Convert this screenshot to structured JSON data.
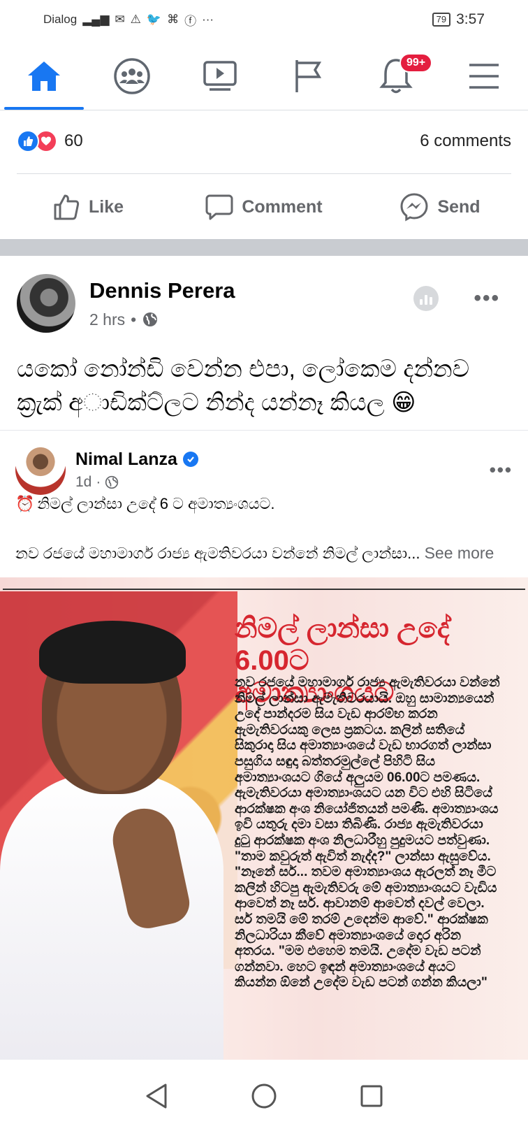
{
  "status_bar": {
    "carrier": "Dialog",
    "battery": "79",
    "time": "3:57",
    "icons": [
      "signal-icon",
      "mail-icon",
      "warning-icon",
      "twitter-icon",
      "app-icon",
      "facebook-icon",
      "more-icon"
    ]
  },
  "nav": {
    "items": [
      "home-icon",
      "groups-icon",
      "watch-icon",
      "pages-icon",
      "notifications-icon",
      "menu-icon"
    ],
    "notifications_badge": "99+",
    "accent": "#1877f2"
  },
  "engagement": {
    "reaction_count": "60",
    "comments_label": "6 comments"
  },
  "actions": {
    "like": "Like",
    "comment": "Comment",
    "send": "Send"
  },
  "post": {
    "author": "Dennis Perera",
    "time": "2 hrs",
    "separator": "•",
    "text_line1": "යකෝ නෝන්ඩි වෙන්න එපා, ලෝකෙම දන්නව",
    "text_line2": "ක්‍රැක් අාඩික්ට්ලට නින්ද යන්නෑ කියල",
    "emoji": "😁"
  },
  "shared": {
    "author": "Nimal Lanza",
    "time": "1d",
    "separator": "·",
    "line1_emoji": "⏰",
    "line1": "නිමල් ලාන්සා උදේ 6 ට අමාත්‍යංශයට.",
    "line2": "නව රජයේ මහාමාර්ග රාජ්‍ය ඇමතිවරයා වන්නේ නිමල් ලාන්සා...",
    "see_more": "See more"
  },
  "news": {
    "headline_1": "නිමල් ලාන්සා උදේ 6.00ට",
    "headline_2": "අමාත්‍යාංශයට",
    "body": "නව රජයේ මහාමාර්ග රාජ්‍ය ඇමැතිවරයා වන්නේ නිමල් ලාන්සා ඇමැතිවරයායි. ඔහු සාමාන්‍යයෙන් උදේ පාන්දරම සිය වැඩ ආරම්භ කරන ඇමැතිවරයකු ලෙස ප්‍රකටය. කලින් සතියේ සිකුරාදා සිය අමාත්‍යාංශයේ වැඩ භාරගත් ලාන්සා පසුගිය සඳුදා බත්තරමුල්ලේ පිහිටි සිය අමාත්‍යාංශයට ගියේ අලුයම 06.00ට පමණය. ඇමැතිවරයා අමාත්‍යාංශයට යන විට එහි සිටියේ ආරක්ෂක අංශ නියෝජිතයන් පමණි. අමාත්‍යාංශය ඉවි යතුරු දමා වසා තිබිණි. රාජ්‍ය ඇමැතිවරයා දුටු ආරක්ෂක අංශ නිලධාරීහු පුදුමයට පත්වුණා. \"තාම කවුරුත් ඇවිත් නැද්ද?\" ලාන්සා ඇසුවේය. \"නෑනේ සර්... තවම අමාත්‍යාංශය ඇරලත් නෑ මීට කලින් හිටපු ඇමැතිවරු මේ අමාත්‍යාංශයට වැඩිය ආවෙත් නෑ සර්. ආවානම් ආවෙත් දවල් වෙලා. සර් තමයි මේ තරම් උදෙන්ම ආවේ.\" ආරක්ෂක නිලධාරියා කීවේ අමාත්‍යාංශයේ දොර අරින අතරය. \"මම එහෙම තමයි. උදේම වැඩ පටන් ගන්නවා. හෙට ඉඳන් අමාත්‍යාංශයේ අයට කියන්න ඕනේ උදේම වැඩ පටන් ගන්න කියලා\""
  },
  "android_nav": [
    "back-icon",
    "home-circle-icon",
    "recents-icon"
  ]
}
